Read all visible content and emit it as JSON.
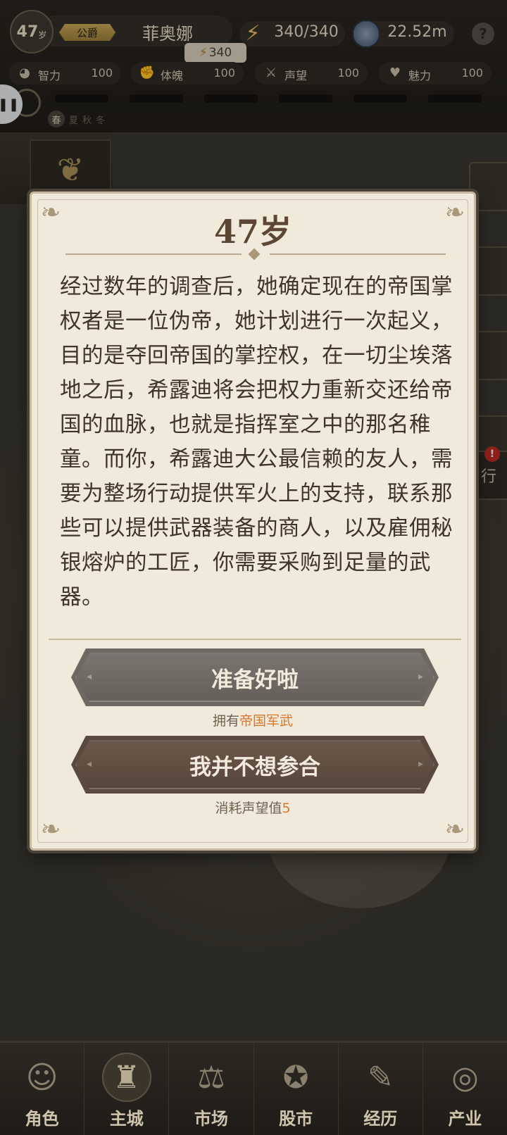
{
  "hud": {
    "age": "47",
    "age_unit": "岁",
    "rank": "公爵",
    "name": "菲奥娜",
    "energy": "340/340",
    "energy_tip": "340",
    "money": "22.52m",
    "help": "?",
    "stats": [
      {
        "icon": "brain-icon",
        "label": "智力",
        "value": "100"
      },
      {
        "icon": "muscle-icon",
        "label": "体魄",
        "value": "100"
      },
      {
        "icon": "reputation-icon",
        "label": "声望",
        "value": "100"
      },
      {
        "icon": "heart-icon",
        "label": "魅力",
        "value": "100"
      }
    ],
    "seasons": {
      "current": "春",
      "others": [
        "夏",
        "秋",
        "冬"
      ]
    }
  },
  "side_tabs": {
    "action_label": "行",
    "action_badge": "!"
  },
  "dialog": {
    "title": "47岁",
    "story": "经过数年的调查后，她确定现在的帝国掌权者是一位伪帝，她计划进行一次起义，目的是夺回帝国的掌控权，在一切尘埃落地之后，希露迪将会把权力重新交还给帝国的血脉，也就是指挥室之中的那名稚童。而你，希露迪大公最信赖的友人，需要为整场行动提供军火上的支持，联系那些可以提供武器装备的商人，以及雇佣秘银熔炉的工匠，你需要采购到足量的武器。",
    "choice_ready": {
      "label": "准备好啦",
      "note_prefix": "拥有",
      "note_highlight": "帝国军武"
    },
    "choice_decline": {
      "label": "我并不想参合",
      "note_prefix": "消耗声望值",
      "note_highlight": "5"
    }
  },
  "nav": [
    {
      "icon": "character-icon",
      "label": "角色"
    },
    {
      "icon": "castle-icon",
      "label": "主城",
      "active": true
    },
    {
      "icon": "scale-icon",
      "label": "市场"
    },
    {
      "icon": "stock-icon",
      "label": "股市"
    },
    {
      "icon": "scroll-icon",
      "label": "经历"
    },
    {
      "icon": "coins-icon",
      "label": "产业"
    }
  ],
  "colors": {
    "accent_orange": "#d8782e",
    "parchment": "#f1e9d9",
    "rank_gold": "#c8a654"
  }
}
